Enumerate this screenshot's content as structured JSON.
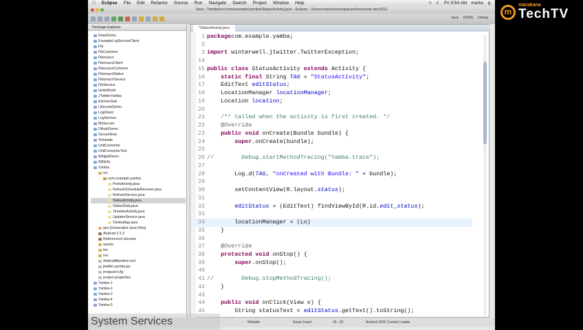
{
  "menubar": {
    "app": "Eclipse",
    "items": [
      "File",
      "Edit",
      "Refactor",
      "Source",
      "Run",
      "Navigate",
      "Search",
      "Project",
      "Window",
      "Help"
    ],
    "clock": "Fri 9:54 AM",
    "user": "marko"
  },
  "window_title": "Java - Yamba/src/com/example/yamba/StatusActivity.java - Eclipse - /Users/marko/workspaces/bootcamp-dec2011",
  "perspectives": [
    "Java",
    "DDMS",
    "Debug"
  ],
  "package_explorer": {
    "title": "Package Explorer",
    "items": [
      {
        "label": "DrawDemo",
        "depth": 0,
        "type": "project"
      },
      {
        "label": "ExampleLogServiceClient",
        "depth": 0,
        "type": "project"
      },
      {
        "label": "Fib",
        "depth": 0,
        "type": "project"
      },
      {
        "label": "FibCommon",
        "depth": 0,
        "type": "project"
      },
      {
        "label": "Fibonacci",
        "depth": 0,
        "type": "project"
      },
      {
        "label": "FibonacciClient",
        "depth": 0,
        "type": "project"
      },
      {
        "label": "FibonacciCommon",
        "depth": 0,
        "type": "project"
      },
      {
        "label": "FibonacciNative",
        "depth": 0,
        "type": "project"
      },
      {
        "label": "FibonacciService",
        "depth": 0,
        "type": "project"
      },
      {
        "label": "FibService",
        "depth": 0,
        "type": "project"
      },
      {
        "label": "HelloWorld",
        "depth": 0,
        "type": "project"
      },
      {
        "label": "JTwitterYamba",
        "depth": 0,
        "type": "project"
      },
      {
        "label": "KitchenSink",
        "depth": 0,
        "type": "project"
      },
      {
        "label": "LifecycleDemo",
        "depth": 0,
        "type": "project"
      },
      {
        "label": "LogClient",
        "depth": 0,
        "type": "project"
      },
      {
        "label": "LogService",
        "depth": 0,
        "type": "project"
      },
      {
        "label": "MySecure",
        "depth": 0,
        "type": "project"
      },
      {
        "label": "OAuthDemo",
        "depth": 0,
        "type": "project"
      },
      {
        "label": "SecureNote",
        "depth": 0,
        "type": "project"
      },
      {
        "label": "Template",
        "depth": 0,
        "type": "project"
      },
      {
        "label": "UnitConverter",
        "depth": 0,
        "type": "project"
      },
      {
        "label": "UnitConverterTest",
        "depth": 0,
        "type": "project"
      },
      {
        "label": "WidgetDemo",
        "depth": 0,
        "type": "project"
      },
      {
        "label": "WifiInfo",
        "depth": 0,
        "type": "project"
      },
      {
        "label": "Yamba",
        "depth": 0,
        "type": "android"
      },
      {
        "label": "src",
        "depth": 1,
        "type": "folder"
      },
      {
        "label": "com.example.yamba",
        "depth": 2,
        "type": "package"
      },
      {
        "label": "PrefsActivity.java",
        "depth": 3,
        "type": "java"
      },
      {
        "label": "RefreshScheduleReceiver.java",
        "depth": 3,
        "type": "java"
      },
      {
        "label": "RefreshService.java",
        "depth": 3,
        "type": "java"
      },
      {
        "label": "StatusActivity.java",
        "depth": 3,
        "type": "java",
        "selected": true
      },
      {
        "label": "StatusData.java",
        "depth": 3,
        "type": "java"
      },
      {
        "label": "TimelineActivity.java",
        "depth": 3,
        "type": "java"
      },
      {
        "label": "UpdaterService.java",
        "depth": 3,
        "type": "java"
      },
      {
        "label": "YambaApp.java",
        "depth": 3,
        "type": "java"
      },
      {
        "label": "gen [Generated Java Files]",
        "depth": 1,
        "type": "folder"
      },
      {
        "label": "Android 2.3.3",
        "depth": 1,
        "type": "lib"
      },
      {
        "label": "Referenced Libraries",
        "depth": 1,
        "type": "lib"
      },
      {
        "label": "assets",
        "depth": 1,
        "type": "folder"
      },
      {
        "label": "bin",
        "depth": 1,
        "type": "folder"
      },
      {
        "label": "res",
        "depth": 1,
        "type": "folder"
      },
      {
        "label": "AndroidManifest.xml",
        "depth": 1,
        "type": "file"
      },
      {
        "label": "jtwitter-yamba.jar",
        "depth": 1,
        "type": "file"
      },
      {
        "label": "proguard.cfg",
        "depth": 1,
        "type": "file"
      },
      {
        "label": "project.properties",
        "depth": 1,
        "type": "file"
      },
      {
        "label": "Yamba-1",
        "depth": 0,
        "type": "project"
      },
      {
        "label": "Yamba-2",
        "depth": 0,
        "type": "project"
      },
      {
        "label": "Yamba-3",
        "depth": 0,
        "type": "project"
      },
      {
        "label": "Yamba-4",
        "depth": 0,
        "type": "project"
      },
      {
        "label": "Yamba-5",
        "depth": 0,
        "type": "project"
      }
    ]
  },
  "editor": {
    "tab": "*StatusActivity.java",
    "lines": [
      {
        "n": "1",
        "segs": [
          [
            "kw",
            "package"
          ],
          [
            "",
            "com.example.yamba;"
          ]
        ]
      },
      {
        "n": "2",
        "segs": []
      },
      {
        "n": "3",
        "segs": [
          [
            "kw",
            "import"
          ],
          [
            "",
            " winterwell.jtwitter.TwitterException;"
          ]
        ]
      },
      {
        "n": "14",
        "segs": []
      },
      {
        "n": "15",
        "segs": [
          [
            "kw",
            "public class"
          ],
          [
            "",
            " StatusActivity "
          ],
          [
            "kw",
            "extends"
          ],
          [
            "",
            " Activity {"
          ]
        ]
      },
      {
        "n": "16",
        "segs": [
          [
            "",
            "    "
          ],
          [
            "kw",
            "static final"
          ],
          [
            "",
            " String "
          ],
          [
            "fld ital",
            "TAG"
          ],
          [
            "",
            " = "
          ],
          [
            "str",
            "\"StatusActivity\""
          ],
          [
            "",
            ";"
          ]
        ]
      },
      {
        "n": "17",
        "segs": [
          [
            "",
            "    EditText "
          ],
          [
            "fld",
            "editStatus"
          ],
          [
            "",
            ";"
          ]
        ]
      },
      {
        "n": "18",
        "segs": [
          [
            "",
            "    LocationManager "
          ],
          [
            "fld",
            "locationManager"
          ],
          [
            "",
            ";"
          ]
        ]
      },
      {
        "n": "19",
        "segs": [
          [
            "",
            "    Location "
          ],
          [
            "fld",
            "location"
          ],
          [
            "",
            ";"
          ]
        ]
      },
      {
        "n": "20",
        "segs": []
      },
      {
        "n": "21",
        "segs": [
          [
            "",
            "    "
          ],
          [
            "cm",
            "/** Called when the activity is first created. */"
          ]
        ]
      },
      {
        "n": "22",
        "segs": [
          [
            "",
            "    "
          ],
          [
            "ann",
            "@Override"
          ]
        ]
      },
      {
        "n": "23",
        "segs": [
          [
            "",
            "    "
          ],
          [
            "kw",
            "public void"
          ],
          [
            "",
            " onCreate(Bundle bundle) {"
          ]
        ]
      },
      {
        "n": "24",
        "segs": [
          [
            "",
            "        "
          ],
          [
            "kw",
            "super"
          ],
          [
            "",
            ".onCreate(bundle);"
          ]
        ]
      },
      {
        "n": "25",
        "segs": []
      },
      {
        "n": "26",
        "segs": [
          [
            "cm",
            "//        Debug.startMethodTracing(\"Yamba.trace\");"
          ]
        ]
      },
      {
        "n": "27",
        "segs": []
      },
      {
        "n": "28",
        "segs": [
          [
            "",
            "        Log."
          ],
          [
            "ital",
            "d"
          ],
          [
            "",
            "("
          ],
          [
            "fld ital",
            "TAG"
          ],
          [
            "",
            ", "
          ],
          [
            "str",
            "\"onCreated with Bundle: \""
          ],
          [
            "",
            " + bundle);"
          ]
        ]
      },
      {
        "n": "29",
        "segs": []
      },
      {
        "n": "30",
        "segs": [
          [
            "",
            "        setContentView(R.layout."
          ],
          [
            "fld ital",
            "status"
          ],
          [
            "",
            ");"
          ]
        ]
      },
      {
        "n": "31",
        "segs": []
      },
      {
        "n": "32",
        "segs": [
          [
            "",
            "        "
          ],
          [
            "fld",
            "editStatus"
          ],
          [
            "",
            " = (EditText) findViewById(R.id."
          ],
          [
            "fld ital",
            "edit_status"
          ],
          [
            "",
            ");"
          ]
        ]
      },
      {
        "n": "33",
        "segs": []
      },
      {
        "n": "34",
        "segs": [
          [
            "",
            "        locationManager = (Lo)"
          ]
        ],
        "current": true
      },
      {
        "n": "35",
        "segs": [
          [
            "",
            "    }"
          ]
        ]
      },
      {
        "n": "36",
        "segs": []
      },
      {
        "n": "37",
        "segs": [
          [
            "",
            "    "
          ],
          [
            "ann",
            "@Override"
          ]
        ]
      },
      {
        "n": "38",
        "segs": [
          [
            "",
            "    "
          ],
          [
            "kw",
            "protected void"
          ],
          [
            "",
            " onStop() {"
          ]
        ]
      },
      {
        "n": "39",
        "segs": [
          [
            "",
            "        "
          ],
          [
            "kw",
            "super"
          ],
          [
            "",
            ".onStop();"
          ]
        ]
      },
      {
        "n": "40",
        "segs": []
      },
      {
        "n": "41",
        "segs": [
          [
            "cm",
            "//        Debug.stopMethodTracing();"
          ]
        ]
      },
      {
        "n": "42",
        "segs": [
          [
            "",
            "    }"
          ]
        ]
      },
      {
        "n": "43",
        "segs": []
      },
      {
        "n": "44",
        "segs": [
          [
            "",
            "    "
          ],
          [
            "kw",
            "public void"
          ],
          [
            "",
            " onClick(View v) {"
          ]
        ]
      },
      {
        "n": "45",
        "segs": [
          [
            "",
            "        String statusText = "
          ],
          [
            "fld",
            "editStatus"
          ],
          [
            "",
            ".getText().toString();"
          ]
        ]
      }
    ]
  },
  "statusbar": {
    "mode": "Writable",
    "insert": "Smart Insert",
    "position": "34 : 30",
    "task": "Android SDK Content Loader"
  },
  "overlay_caption": "System Services",
  "logo": {
    "brand": "marakana",
    "name": "TechTV"
  },
  "colors": {
    "keyword": "#7f0055",
    "string": "#2a00ff",
    "field": "#0000c0",
    "comment": "#3f7f5f",
    "logo": "#f39a1e"
  }
}
